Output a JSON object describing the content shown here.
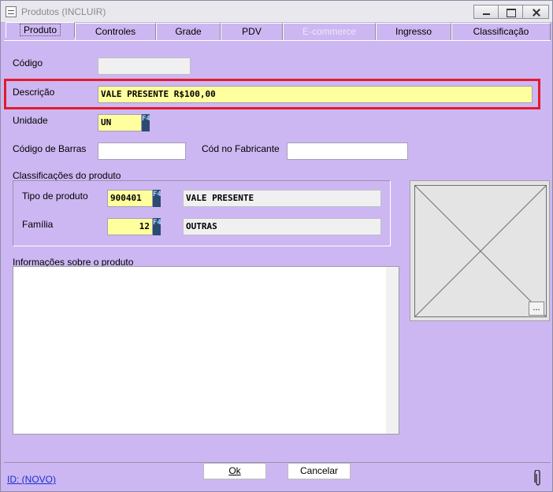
{
  "window": {
    "title": "Produtos (INCLUIR)"
  },
  "tabs": [
    {
      "label": "Produto"
    },
    {
      "label": "Controles"
    },
    {
      "label": "Grade"
    },
    {
      "label": "PDV"
    },
    {
      "label": "E-commerce"
    },
    {
      "label": "Ingresso"
    },
    {
      "label": "Classificação"
    }
  ],
  "form": {
    "codigo": {
      "label": "Código",
      "value": ""
    },
    "descricao": {
      "label": "Descrição",
      "value": "VALE PRESENTE R$100,00"
    },
    "unidade": {
      "label": "Unidade",
      "value": "UN",
      "key_hint": "F4"
    },
    "codigo_barras": {
      "label": "Código de Barras",
      "value": ""
    },
    "cod_fabricante": {
      "label": "Cód no Fabricante",
      "value": ""
    }
  },
  "classificacoes": {
    "title": "Classificações do produto",
    "tipo_produto": {
      "label": "Tipo de produto",
      "code": "900401",
      "key_hint": "F4",
      "description": "VALE PRESENTE"
    },
    "familia": {
      "label": "Família",
      "code": "12",
      "key_hint": "F4",
      "description": "OUTRAS"
    }
  },
  "informacoes": {
    "label": "Informações sobre o produto",
    "value": ""
  },
  "image_panel": {
    "browse_label": "..."
  },
  "buttons": {
    "ok": "Ok",
    "cancelar": "Cancelar"
  },
  "footer": {
    "id_text": "ID: (NOVO)"
  },
  "icons": {
    "app": "app-grid-icon",
    "attachment": "paperclip-icon",
    "image_placeholder": "empty-image-icon"
  },
  "colors": {
    "window_bg": "#cdb7f2",
    "required_field": "#ffff9e",
    "highlight": "#e21b2c",
    "link": "#1a2fd0"
  }
}
